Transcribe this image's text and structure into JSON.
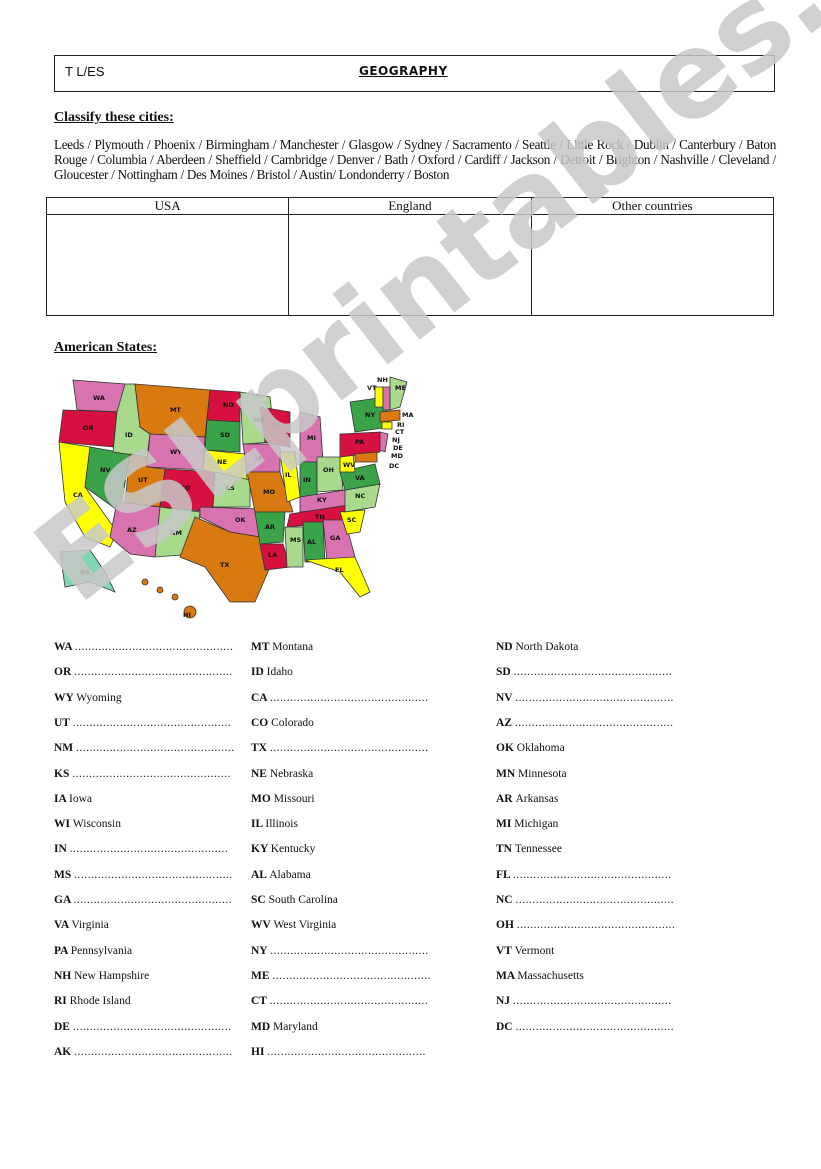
{
  "header": {
    "class_code": "T L/ES",
    "title": "GEOGRAPHY"
  },
  "classify": {
    "heading": "Classify these cities:",
    "cities_text": "Leeds / Plymouth / Phoenix / Birmingham / Manchester / Glasgow / Sydney / Sacramento / Seattle / Little Rock / Dublin / Canterbury / Baton Rouge / Columbia / Aberdeen / Sheffield / Cambridge / Denver / Bath / Oxford / Cardiff / Jackson / Detroit / Brighton / Nashville / Cleveland / Gloucester / Nottingham / Des Moines / Bristol / Austin/ Londonderry / Boston",
    "columns": [
      "USA",
      "England",
      "Other countries"
    ]
  },
  "states_section": {
    "heading": "American States:"
  },
  "map": {
    "colors": {
      "red": "#d6103f",
      "orange": "#d97a10",
      "pink": "#d873b0",
      "lightgreen": "#a8d98c",
      "green": "#3aa34a",
      "yellow": "#ffff00",
      "teal": "#7fd6b0"
    },
    "labels": [
      "WA",
      "OR",
      "ID",
      "MT",
      "WY",
      "ND",
      "SD",
      "MN",
      "WI",
      "MI",
      "NY",
      "VT",
      "NH",
      "ME",
      "MA",
      "RI",
      "CT",
      "NJ",
      "DE",
      "MD",
      "DC",
      "PA",
      "OH",
      "IN",
      "IL",
      "IA",
      "NE",
      "NV",
      "CA",
      "UT",
      "CO",
      "KS",
      "MO",
      "KY",
      "WV",
      "VA",
      "NC",
      "TN",
      "SC",
      "GA",
      "AL",
      "MS",
      "AR",
      "LA",
      "OK",
      "TX",
      "NM",
      "AZ",
      "FL",
      "AK",
      "HI"
    ]
  },
  "state_list": {
    "blank": "...............................................",
    "col1": [
      {
        "abbr": "WA",
        "name": ""
      },
      {
        "abbr": "OR",
        "name": ""
      },
      {
        "abbr": "WY",
        "name": "Wyoming"
      },
      {
        "abbr": "UT",
        "name": ""
      },
      {
        "abbr": "NM",
        "name": ""
      },
      {
        "abbr": "KS",
        "name": ""
      },
      {
        "abbr": "IA",
        "name": "Iowa"
      },
      {
        "abbr": "WI",
        "name": "Wisconsin"
      },
      {
        "abbr": "IN",
        "name": ""
      },
      {
        "abbr": "MS",
        "name": ""
      },
      {
        "abbr": "GA",
        "name": ""
      },
      {
        "abbr": "VA",
        "name": "Virginia"
      },
      {
        "abbr": "PA",
        "name": "Pennsylvania"
      },
      {
        "abbr": "NH",
        "name": "New Hampshire"
      },
      {
        "abbr": "RI",
        "name": "Rhode Island"
      },
      {
        "abbr": "DE",
        "name": ""
      },
      {
        "abbr": "AK",
        "name": ""
      }
    ],
    "col2": [
      {
        "abbr": "MT",
        "name": "Montana"
      },
      {
        "abbr": "ID",
        "name": "Idaho"
      },
      {
        "abbr": "CA",
        "name": ""
      },
      {
        "abbr": "CO",
        "name": "Colorado"
      },
      {
        "abbr": "TX",
        "name": ""
      },
      {
        "abbr": "NE",
        "name": "Nebraska"
      },
      {
        "abbr": "MO",
        "name": "Missouri"
      },
      {
        "abbr": "IL",
        "name": "Illinois"
      },
      {
        "abbr": "KY",
        "name": "Kentucky"
      },
      {
        "abbr": "AL",
        "name": "Alabama"
      },
      {
        "abbr": "SC",
        "name": "South Carolina"
      },
      {
        "abbr": "WV",
        "name": "West Virginia"
      },
      {
        "abbr": "NY",
        "name": ""
      },
      {
        "abbr": "ME",
        "name": ""
      },
      {
        "abbr": "CT",
        "name": ""
      },
      {
        "abbr": "MD",
        "name": "Maryland"
      },
      {
        "abbr": "HI",
        "name": ""
      }
    ],
    "col3": [
      {
        "abbr": "ND",
        "name": "North Dakota"
      },
      {
        "abbr": "SD",
        "name": ""
      },
      {
        "abbr": "NV",
        "name": ""
      },
      {
        "abbr": "AZ",
        "name": ""
      },
      {
        "abbr": "OK",
        "name": "Oklahoma"
      },
      {
        "abbr": "MN",
        "name": "Minnesota"
      },
      {
        "abbr": "AR",
        "name": "Arkansas"
      },
      {
        "abbr": "MI",
        "name": "Michigan"
      },
      {
        "abbr": "TN",
        "name": "Tennessee"
      },
      {
        "abbr": "FL",
        "name": ""
      },
      {
        "abbr": "NC",
        "name": ""
      },
      {
        "abbr": "OH",
        "name": ""
      },
      {
        "abbr": "VT",
        "name": "Vermont"
      },
      {
        "abbr": "MA",
        "name": "Massachusetts"
      },
      {
        "abbr": "NJ",
        "name": ""
      },
      {
        "abbr": "DC",
        "name": ""
      }
    ]
  },
  "watermark": "ESLprintables.com"
}
